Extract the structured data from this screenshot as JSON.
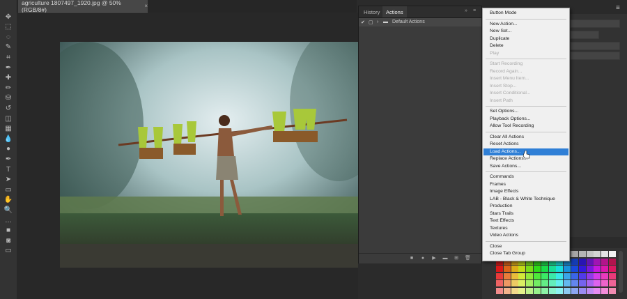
{
  "document": {
    "tab_title": "agriculture 1807497_1920.jpg @ 50% (RGB/8#)",
    "close": "×"
  },
  "panel": {
    "tabs": [
      "History",
      "Actions"
    ],
    "active_tab": "Actions",
    "controls": [
      "»",
      "≡"
    ],
    "action_set": "Default Actions"
  },
  "menu": {
    "items": [
      {
        "label": "Button Mode",
        "disabled": false
      },
      {
        "sep": true
      },
      {
        "label": "New Action...",
        "disabled": false
      },
      {
        "label": "New Set...",
        "disabled": false
      },
      {
        "label": "Duplicate",
        "disabled": false
      },
      {
        "label": "Delete",
        "disabled": false
      },
      {
        "label": "Play",
        "disabled": true
      },
      {
        "sep": true
      },
      {
        "label": "Start Recording",
        "disabled": true
      },
      {
        "label": "Record Again...",
        "disabled": true
      },
      {
        "label": "Insert Menu Item...",
        "disabled": true
      },
      {
        "label": "Insert Stop...",
        "disabled": true
      },
      {
        "label": "Insert Conditional...",
        "disabled": true
      },
      {
        "label": "Insert Path",
        "disabled": true
      },
      {
        "sep": true
      },
      {
        "label": "Set Options...",
        "disabled": false
      },
      {
        "label": "Playback Options...",
        "disabled": false
      },
      {
        "label": "Allow Tool Recording",
        "disabled": false
      },
      {
        "sep": true
      },
      {
        "label": "Clear All Actions",
        "disabled": false
      },
      {
        "label": "Reset Actions",
        "disabled": false
      },
      {
        "label": "Load Actions...",
        "disabled": false,
        "highlighted": true
      },
      {
        "label": "Replace Actions...",
        "disabled": false
      },
      {
        "label": "Save Actions...",
        "disabled": false
      },
      {
        "sep": true
      },
      {
        "label": "Commands",
        "disabled": false
      },
      {
        "label": "Frames",
        "disabled": false
      },
      {
        "label": "Image Effects",
        "disabled": false
      },
      {
        "label": "LAB - Black & White Technique",
        "disabled": false
      },
      {
        "label": "Production",
        "disabled": false
      },
      {
        "label": "Stars Trails",
        "disabled": false
      },
      {
        "label": "Text Effects",
        "disabled": false
      },
      {
        "label": "Textures",
        "disabled": false
      },
      {
        "label": "Video Actions",
        "disabled": false
      },
      {
        "sep": true
      },
      {
        "label": "Close",
        "disabled": false
      },
      {
        "label": "Close Tab Group",
        "disabled": false
      }
    ]
  },
  "tools": [
    "move-tool",
    "marquee-tool",
    "lasso-tool",
    "quick-select-tool",
    "crop-tool",
    "eyedropper-tool",
    "healing-tool",
    "brush-tool",
    "clone-stamp-tool",
    "history-brush-tool",
    "eraser-tool",
    "gradient-tool",
    "blur-tool",
    "dodge-tool",
    "pen-tool",
    "type-tool",
    "path-select-tool",
    "rectangle-tool",
    "hand-tool",
    "zoom-tool",
    "more-tools",
    "color-swatches",
    "quick-mask",
    "screen-mode"
  ],
  "colors": {
    "highlight": "#2f7fd6",
    "menu_bg": "#f0f0f0",
    "panel_bg": "#3b3b3b"
  }
}
